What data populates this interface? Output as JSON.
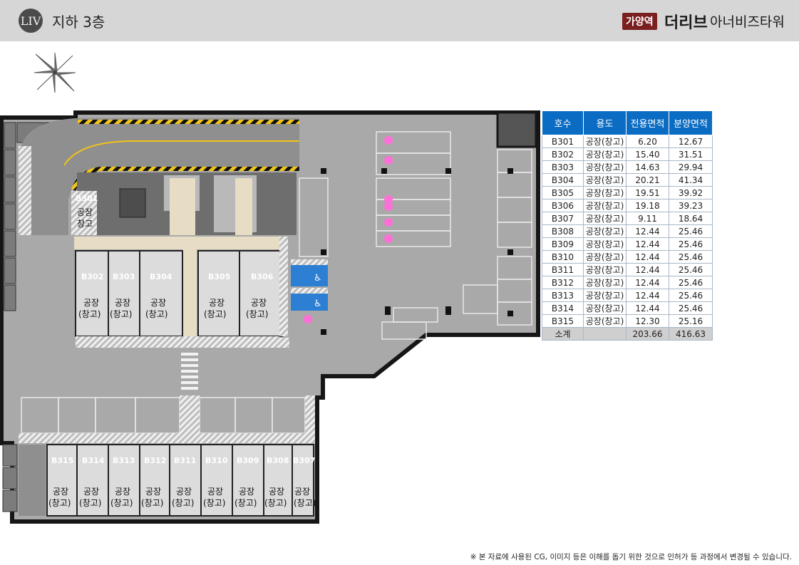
{
  "header": {
    "logo_text": "LIV",
    "floor_title": "지하 3층",
    "station_badge": "가양역",
    "brand_main": "더리브",
    "brand_sub": "아너비즈타워"
  },
  "compass": {
    "icon": "compass-rose-icon"
  },
  "plan": {
    "upper_units": [
      {
        "id": "B301",
        "use_line1": "공장",
        "use_line2": "창고"
      },
      {
        "id": "B302",
        "use_line1": "공장",
        "use_line2": "(창고)"
      },
      {
        "id": "B303",
        "use_line1": "공장",
        "use_line2": "(창고)"
      },
      {
        "id": "B304",
        "use_line1": "공장",
        "use_line2": "(창고)"
      },
      {
        "id": "B305",
        "use_line1": "공장",
        "use_line2": "(창고)"
      },
      {
        "id": "B306",
        "use_line1": "공장",
        "use_line2": "(창고)"
      }
    ],
    "lower_units": [
      {
        "id": "B315",
        "use_line1": "공장",
        "use_line2": "(창고)"
      },
      {
        "id": "B314",
        "use_line1": "공장",
        "use_line2": "(창고)"
      },
      {
        "id": "B313",
        "use_line1": "공장",
        "use_line2": "(창고)"
      },
      {
        "id": "B312",
        "use_line1": "공장",
        "use_line2": "(창고)"
      },
      {
        "id": "B311",
        "use_line1": "공장",
        "use_line2": "(창고)"
      },
      {
        "id": "B310",
        "use_line1": "공장",
        "use_line2": "(창고)"
      },
      {
        "id": "B309",
        "use_line1": "공장",
        "use_line2": "(창고)"
      },
      {
        "id": "B308",
        "use_line1": "공장",
        "use_line2": "(창고)"
      },
      {
        "id": "B307",
        "use_line1": "공장",
        "use_line2": "(창고)"
      }
    ],
    "colors": {
      "floor": "#a9a9a9",
      "wall": "#161616",
      "unit": "#dcdcdc",
      "corridor": "#e7dcc4",
      "accessible": "#2c7fd2",
      "ev_marker": "#ff6fd8",
      "hazard": "#f0c419"
    }
  },
  "table": {
    "headers": [
      "호수",
      "용도",
      "전용면적",
      "분양면적"
    ],
    "rows": [
      [
        "B301",
        "공장(창고)",
        "6.20",
        "12.67"
      ],
      [
        "B302",
        "공장(창고)",
        "15.40",
        "31.51"
      ],
      [
        "B303",
        "공장(창고)",
        "14.63",
        "29.94"
      ],
      [
        "B304",
        "공장(창고)",
        "20.21",
        "41.34"
      ],
      [
        "B305",
        "공장(창고)",
        "19.51",
        "39.92"
      ],
      [
        "B306",
        "공장(창고)",
        "19.18",
        "39.23"
      ],
      [
        "B307",
        "공장(창고)",
        "9.11",
        "18.64"
      ],
      [
        "B308",
        "공장(창고)",
        "12.44",
        "25.46"
      ],
      [
        "B309",
        "공장(창고)",
        "12.44",
        "25.46"
      ],
      [
        "B310",
        "공장(창고)",
        "12.44",
        "25.46"
      ],
      [
        "B311",
        "공장(창고)",
        "12.44",
        "25.46"
      ],
      [
        "B312",
        "공장(창고)",
        "12.44",
        "25.46"
      ],
      [
        "B313",
        "공장(창고)",
        "12.44",
        "25.46"
      ],
      [
        "B314",
        "공장(창고)",
        "12.44",
        "25.46"
      ],
      [
        "B315",
        "공장(창고)",
        "12.30",
        "25.16"
      ]
    ],
    "total": [
      "소계",
      "",
      "203.66",
      "416.63"
    ]
  },
  "footnote": "※ 본 자료에 사용된 CG, 이미지 등은 이해를 돕기 위한 것으로 인허가 등 과정에서 변경될 수 있습니다."
}
